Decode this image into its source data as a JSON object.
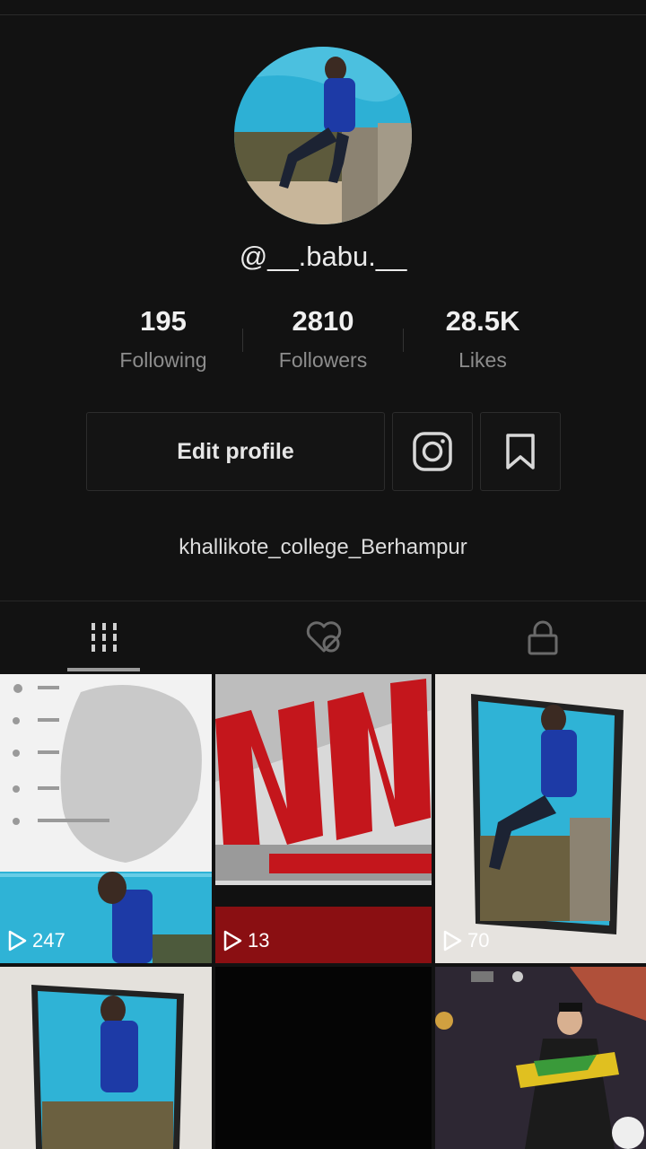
{
  "profile": {
    "username": "@__.babu.__",
    "bio": "khallikote_college_Berhampur"
  },
  "stats": [
    {
      "value": "195",
      "label": "Following"
    },
    {
      "value": "2810",
      "label": "Followers"
    },
    {
      "value": "28.5K",
      "label": "Likes"
    }
  ],
  "actions": {
    "edit_profile": "Edit profile",
    "instagram_icon": "instagram-icon",
    "bookmark_icon": "bookmark-icon"
  },
  "tabs": [
    {
      "name": "videos",
      "icon": "grid-icon",
      "active": true
    },
    {
      "name": "liked",
      "icon": "hidden-heart-icon",
      "active": false
    },
    {
      "name": "private",
      "icon": "lock-icon",
      "active": false
    }
  ],
  "videos": [
    {
      "views": "247"
    },
    {
      "views": "13"
    },
    {
      "views": "70"
    },
    {
      "views": ""
    },
    {
      "views": ""
    },
    {
      "views": ""
    }
  ],
  "colors": {
    "background": "#121212",
    "accent_red": "#c4161c",
    "sky_blue": "#2fb3d6"
  }
}
